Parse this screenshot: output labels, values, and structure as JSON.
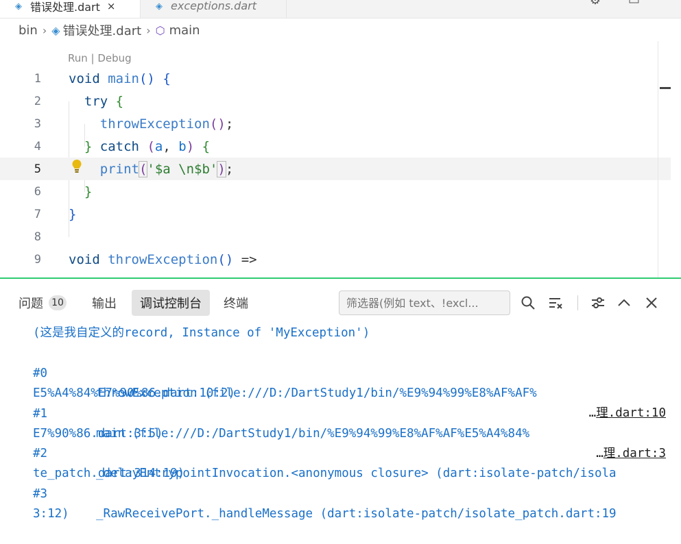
{
  "tabs": {
    "active_label": "错误处理.dart",
    "inactive_label": "exceptions.dart",
    "close_glyph": "×"
  },
  "breadcrumb": {
    "folder": "bin",
    "file": "错误处理.dart",
    "symbol": "main"
  },
  "editor": {
    "codelens": "Run | Debug",
    "lines": [
      {
        "num": "1"
      },
      {
        "num": "2"
      },
      {
        "num": "3"
      },
      {
        "num": "4"
      },
      {
        "num": "5"
      },
      {
        "num": "6"
      },
      {
        "num": "7"
      },
      {
        "num": "8"
      },
      {
        "num": "9"
      }
    ],
    "code": {
      "l1_void": "void",
      "l1_main": "main",
      "l1_parens": "()",
      "l1_brace": "{",
      "l2_try": "try",
      "l2_brace": "{",
      "l3_call": "throwException",
      "l3_parens": "()",
      "l3_semi": ";",
      "l4_close": "}",
      "l4_catch": "catch",
      "l4_open": "(",
      "l4_a": "a",
      "l4_comma": ", ",
      "l4_b": "b",
      "l4_close2": ")",
      "l4_brace": "{",
      "l5_print": "print",
      "l5_open": "(",
      "l5_str": "'$a \\n$b'",
      "l5_close": ")",
      "l5_semi": ";",
      "l6_brace": "}",
      "l7_brace": "}",
      "l9_void": "void",
      "l9_name": "throwException",
      "l9_parens": "()",
      "l9_arrow": "=>"
    }
  },
  "panel": {
    "tabs": [
      {
        "label": "问题",
        "count": "10"
      },
      {
        "label": "输出"
      },
      {
        "label": "调试控制台"
      },
      {
        "label": "终端"
      }
    ],
    "filter_placeholder": "筛选器(例如 text、!excl...",
    "output_line": "(这是我自定义的record, Instance of 'MyException')",
    "frames": [
      {
        "num": "#0",
        "text": "throwException (file:///D:/DartStudy1/bin/%E9%94%99%E8%AF%AF%",
        "link_prefix": "…",
        "link": "理.dart:10",
        "cont": "E5%A4%84%E7%90%86.dart:10:2)"
      },
      {
        "num": "#1",
        "text": "main (file:///D:/DartStudy1/bin/%E9%94%99%E8%AF%AF%E5%A4%84%",
        "link_prefix": "…",
        "link": "理.dart:3",
        "cont": "E7%90%86.dart:3:5)"
      },
      {
        "num": "#2",
        "text": "_delayEntrypointInvocation.<anonymous closure> (dart:isolate-patch/isola",
        "cont": "te_patch.dart:314:19)"
      },
      {
        "num": "#3",
        "text": "_RawReceivePort._handleMessage (dart:isolate-patch/isolate_patch.dart:19",
        "cont": "3:12)"
      }
    ]
  }
}
